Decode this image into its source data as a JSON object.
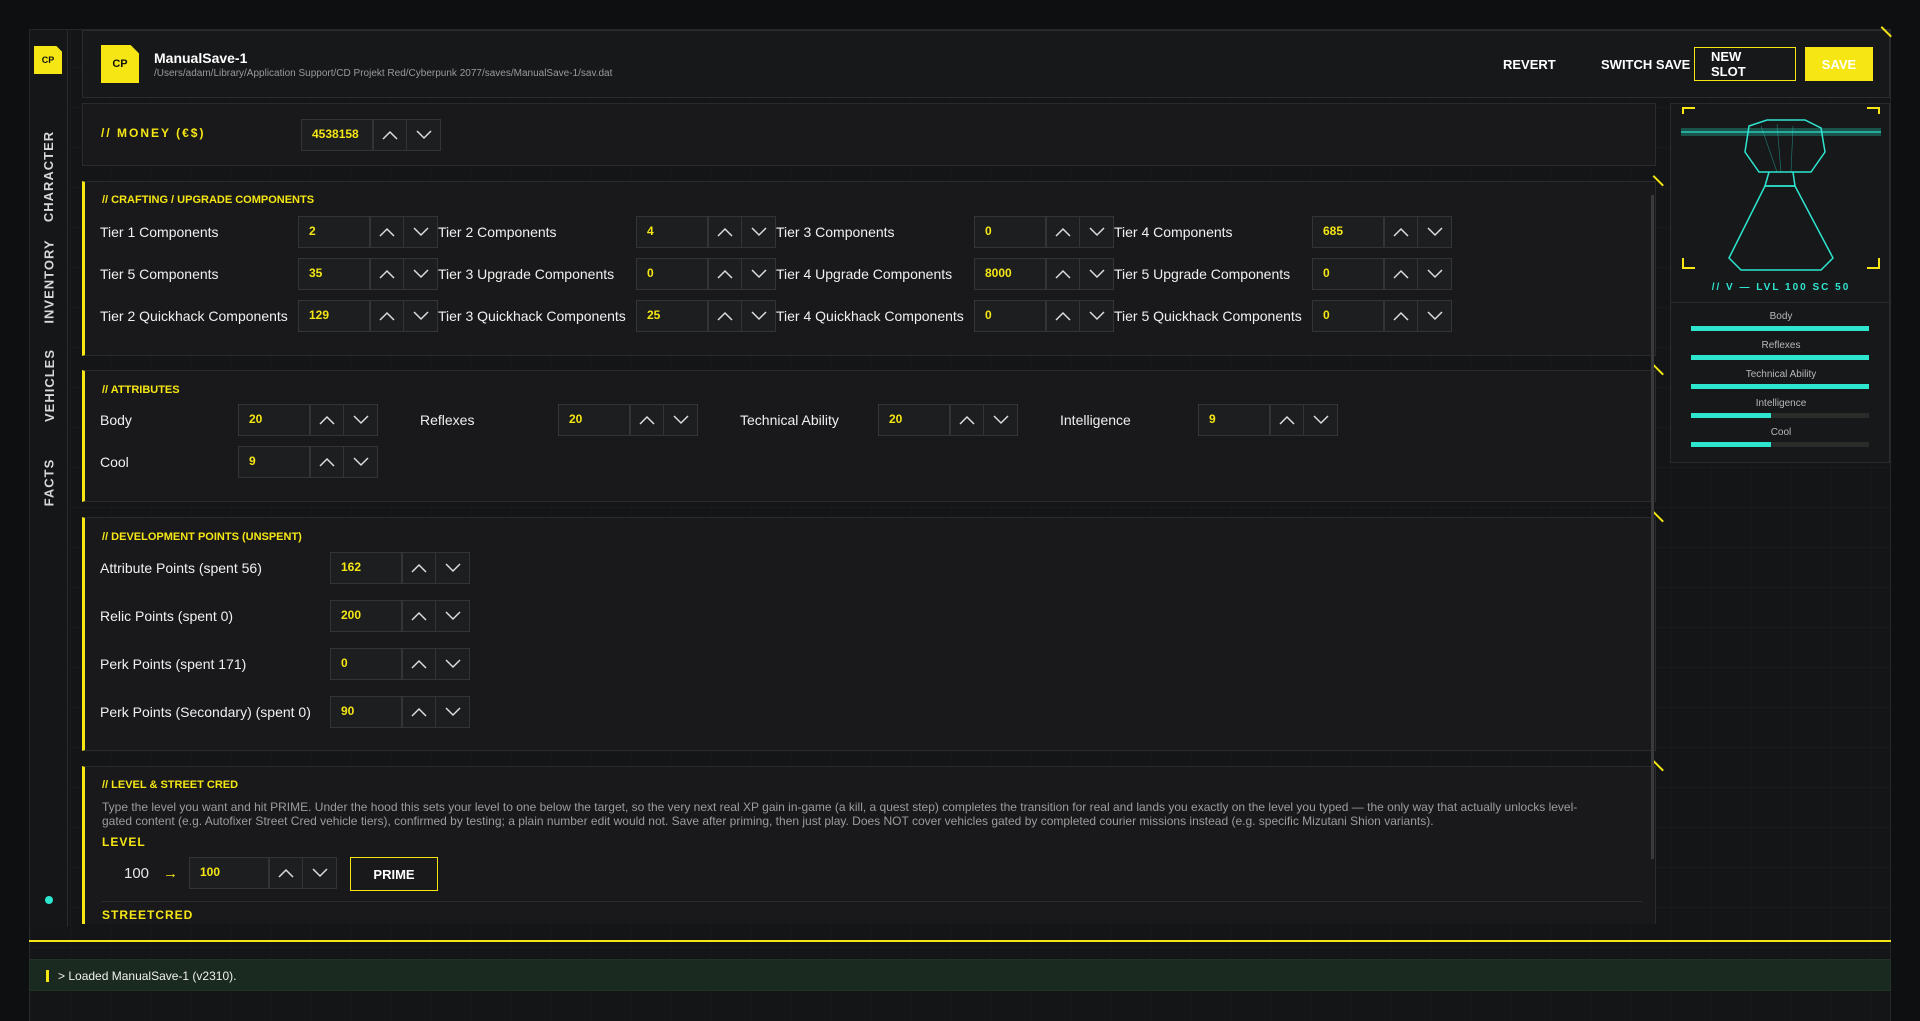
{
  "colors": {
    "accent": "#f5e614",
    "teal": "#2ee6d0",
    "bg": "#141517",
    "panel": "#19191b"
  },
  "sidebar": {
    "logo": "CP",
    "tabs": [
      "CHARACTER",
      "INVENTORY",
      "VEHICLES",
      "FACTS"
    ]
  },
  "header": {
    "logo": "CP",
    "save_name": "ManualSave-1",
    "save_path": "/Users/adam/Library/Application Support/CD Projekt Red/Cyberpunk 2077/saves/ManualSave-1/sav.dat",
    "buttons": {
      "revert": "REVERT",
      "switch_save": "SWITCH SAVE",
      "new_slot": "NEW SLOT",
      "save": "SAVE"
    }
  },
  "money": {
    "title": "// MONEY (€$)",
    "value": "4538158"
  },
  "crafting": {
    "title": "// CRAFTING / UPGRADE COMPONENTS",
    "rows": [
      [
        {
          "label": "Tier 1 Components",
          "value": "2"
        },
        {
          "label": "Tier 2 Components",
          "value": "4"
        },
        {
          "label": "Tier 3 Components",
          "value": "0"
        },
        {
          "label": "Tier 4 Components",
          "value": "685"
        }
      ],
      [
        {
          "label": "Tier 5 Components",
          "value": "35"
        },
        {
          "label": "Tier 3 Upgrade Components",
          "value": "0"
        },
        {
          "label": "Tier 4 Upgrade Components",
          "value": "8000"
        },
        {
          "label": "Tier 5 Upgrade Components",
          "value": "0"
        }
      ],
      [
        {
          "label": "Tier 2 Quickhack Components",
          "value": "129"
        },
        {
          "label": "Tier 3 Quickhack Components",
          "value": "25"
        },
        {
          "label": "Tier 4 Quickhack Components",
          "value": "0"
        },
        {
          "label": "Tier 5 Quickhack Components",
          "value": "0"
        }
      ]
    ]
  },
  "attributes": {
    "title": "// ATTRIBUTES",
    "items": [
      {
        "label": "Body",
        "value": "20"
      },
      {
        "label": "Reflexes",
        "value": "20"
      },
      {
        "label": "Technical Ability",
        "value": "20"
      },
      {
        "label": "Intelligence",
        "value": "9"
      },
      {
        "label": "Cool",
        "value": "9"
      }
    ]
  },
  "dev_points": {
    "title": "// DEVELOPMENT POINTS (UNSPENT)",
    "items": [
      {
        "label": "Attribute Points (spent 56)",
        "value": "162"
      },
      {
        "label": "Relic Points (spent 0)",
        "value": "200"
      },
      {
        "label": "Perk Points (spent 171)",
        "value": "0"
      },
      {
        "label": "Perk Points (Secondary) (spent 0)",
        "value": "90"
      }
    ]
  },
  "level": {
    "title": "// LEVEL & STREET CRED",
    "description": "Type the level you want and hit PRIME. Under the hood this sets your level to one below the target, so the very next real XP gain in-game (a kill, a quest step) completes the transition for real and lands you exactly on the level you typed — the only way that actually unlocks level-gated content (e.g. Autofixer Street Cred vehicle tiers), confirmed by testing; a plain number edit would not. Save after priming, then just play. Does NOT cover vehicles gated by completed courier missions instead (e.g. specific Mizutani Shion variants).",
    "level_label": "LEVEL",
    "current": "100",
    "arrow": "→",
    "target": "100",
    "prime": "PRIME",
    "streetcred_label": "STREETCRED"
  },
  "preview": {
    "caption": "// V — LVL 100  SC 50",
    "stats": [
      {
        "label": "Body",
        "fill": 1.0
      },
      {
        "label": "Reflexes",
        "fill": 1.0
      },
      {
        "label": "Technical Ability",
        "fill": 1.0
      },
      {
        "label": "Intelligence",
        "fill": 0.45
      },
      {
        "label": "Cool",
        "fill": 0.45
      }
    ]
  },
  "log": {
    "text": "> Loaded ManualSave-1 (v2310)."
  }
}
